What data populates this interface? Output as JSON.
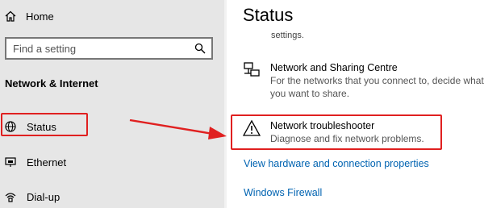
{
  "sidebar": {
    "home_label": "Home",
    "search_placeholder": "Find a setting",
    "section_title": "Network & Internet",
    "items": [
      {
        "label": "Status",
        "icon": "globe-icon"
      },
      {
        "label": "Ethernet",
        "icon": "ethernet-icon"
      },
      {
        "label": "Dial-up",
        "icon": "dialup-icon"
      }
    ]
  },
  "main": {
    "title": "Status",
    "truncated_text": "settings.",
    "entries": [
      {
        "title": "Network and Sharing Centre",
        "desc_line1": "For the networks that you connect to, decide what",
        "desc_line2": "you want to share.",
        "icon": "sharing-centre-icon"
      },
      {
        "title": "Network troubleshooter",
        "desc_line1": "Diagnose and fix network problems.",
        "icon": "warning-icon"
      }
    ],
    "links": [
      "View hardware and connection properties",
      "Windows Firewall"
    ]
  },
  "colors": {
    "highlight": "#e02020",
    "link": "#0063b1",
    "sidebar_bg": "#e6e6e6"
  }
}
